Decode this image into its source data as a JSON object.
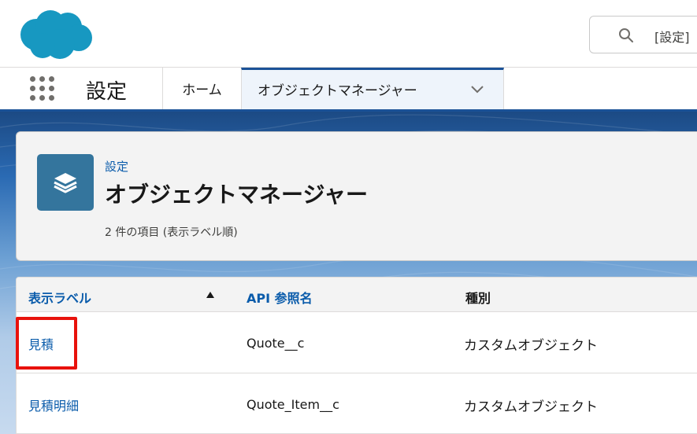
{
  "header": {
    "search_placeholder": "[設定]"
  },
  "context_bar": {
    "app_name": "設定",
    "tabs": [
      {
        "label": "ホーム"
      },
      {
        "label": "オブジェクトマネージャー"
      }
    ]
  },
  "page_header": {
    "breadcrumb": "設定",
    "title": "オブジェクトマネージャー",
    "item_count": "2 件の項目 (表示ラベル順)"
  },
  "table": {
    "columns": [
      "表示ラベル",
      "API 参照名",
      "種別"
    ],
    "rows": [
      {
        "label": "見積",
        "api_name": "Quote__c",
        "type": "カスタムオブジェクト"
      },
      {
        "label": "見積明細",
        "api_name": "Quote_Item__c",
        "type": "カスタムオブジェクト"
      }
    ]
  },
  "colors": {
    "brand_blue": "#1b5297",
    "link_blue": "#0b5cab",
    "logo_blue": "#1798c1",
    "icon_teal": "#34759d",
    "highlight_red": "#e8120c"
  },
  "icons": {
    "logo": "salesforce-cloud-logo",
    "search": "search-icon",
    "app_launcher": "grid-icon",
    "tab_menu": "chevron-down-icon",
    "object": "layers-icon",
    "sort": "sort-ascending-icon"
  }
}
